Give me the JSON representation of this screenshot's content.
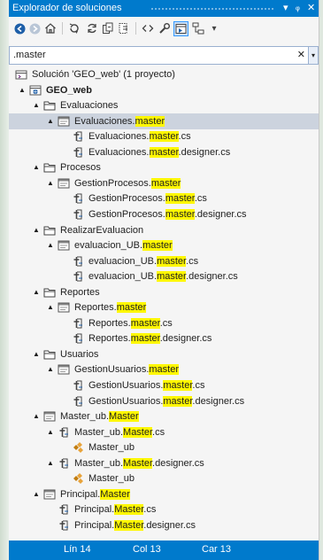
{
  "window": {
    "title": "Explorador de soluciones",
    "menu_glyph": "▾",
    "pin_glyph": "ᵩ",
    "close_glyph": "✕"
  },
  "search": {
    "value": ".master",
    "clear_glyph": "✕",
    "dropdown_glyph": "▾"
  },
  "tree": [
    {
      "depth": 0,
      "expander": "",
      "icon": "solution-icon",
      "parts": [
        {
          "t": "Solución 'GEO_web' (1 proyecto)"
        }
      ]
    },
    {
      "depth": 1,
      "expander": "▲",
      "icon": "web-project-icon",
      "bold": true,
      "parts": [
        {
          "t": "GEO_web"
        }
      ]
    },
    {
      "depth": 2,
      "expander": "▲",
      "icon": "folder-icon",
      "parts": [
        {
          "t": "Evaluaciones"
        }
      ]
    },
    {
      "depth": 3,
      "expander": "▲",
      "icon": "master-page-icon",
      "selected": true,
      "parts": [
        {
          "t": "Evaluaciones."
        },
        {
          "t": "master",
          "hl": true
        }
      ]
    },
    {
      "depth": 4,
      "expander": "",
      "icon": "cs-file-icon",
      "parts": [
        {
          "t": "Evaluaciones."
        },
        {
          "t": "master",
          "hl": true
        },
        {
          "t": ".cs"
        }
      ]
    },
    {
      "depth": 4,
      "expander": "",
      "icon": "cs-file-icon",
      "parts": [
        {
          "t": "Evaluaciones."
        },
        {
          "t": "master",
          "hl": true
        },
        {
          "t": ".designer.cs"
        }
      ]
    },
    {
      "depth": 2,
      "expander": "▲",
      "icon": "folder-icon",
      "parts": [
        {
          "t": "Procesos"
        }
      ]
    },
    {
      "depth": 3,
      "expander": "▲",
      "icon": "master-page-icon",
      "parts": [
        {
          "t": "GestionProcesos."
        },
        {
          "t": "master",
          "hl": true
        }
      ]
    },
    {
      "depth": 4,
      "expander": "",
      "icon": "cs-file-icon",
      "parts": [
        {
          "t": "GestionProcesos."
        },
        {
          "t": "master",
          "hl": true
        },
        {
          "t": ".cs"
        }
      ]
    },
    {
      "depth": 4,
      "expander": "",
      "icon": "cs-file-icon",
      "parts": [
        {
          "t": "GestionProcesos."
        },
        {
          "t": "master",
          "hl": true
        },
        {
          "t": ".designer.cs"
        }
      ]
    },
    {
      "depth": 2,
      "expander": "▲",
      "icon": "folder-icon",
      "parts": [
        {
          "t": "RealizarEvaluacion"
        }
      ]
    },
    {
      "depth": 3,
      "expander": "▲",
      "icon": "master-page-icon",
      "parts": [
        {
          "t": "evaluacion_UB."
        },
        {
          "t": "master",
          "hl": true
        }
      ]
    },
    {
      "depth": 4,
      "expander": "",
      "icon": "cs-file-icon",
      "parts": [
        {
          "t": "evaluacion_UB."
        },
        {
          "t": "master",
          "hl": true
        },
        {
          "t": ".cs"
        }
      ]
    },
    {
      "depth": 4,
      "expander": "",
      "icon": "cs-file-icon",
      "parts": [
        {
          "t": "evaluacion_UB."
        },
        {
          "t": "master",
          "hl": true
        },
        {
          "t": ".designer.cs"
        }
      ]
    },
    {
      "depth": 2,
      "expander": "▲",
      "icon": "folder-icon",
      "parts": [
        {
          "t": "Reportes"
        }
      ]
    },
    {
      "depth": 3,
      "expander": "▲",
      "icon": "master-page-icon",
      "parts": [
        {
          "t": "Reportes."
        },
        {
          "t": "master",
          "hl": true
        }
      ]
    },
    {
      "depth": 4,
      "expander": "",
      "icon": "cs-file-icon",
      "parts": [
        {
          "t": "Reportes."
        },
        {
          "t": "master",
          "hl": true
        },
        {
          "t": ".cs"
        }
      ]
    },
    {
      "depth": 4,
      "expander": "",
      "icon": "cs-file-icon",
      "parts": [
        {
          "t": "Reportes."
        },
        {
          "t": "master",
          "hl": true
        },
        {
          "t": ".designer.cs"
        }
      ]
    },
    {
      "depth": 2,
      "expander": "▲",
      "icon": "folder-icon",
      "parts": [
        {
          "t": "Usuarios"
        }
      ]
    },
    {
      "depth": 3,
      "expander": "▲",
      "icon": "master-page-icon",
      "parts": [
        {
          "t": "GestionUsuarios."
        },
        {
          "t": "master",
          "hl": true
        }
      ]
    },
    {
      "depth": 4,
      "expander": "",
      "icon": "cs-file-icon",
      "parts": [
        {
          "t": "GestionUsuarios."
        },
        {
          "t": "master",
          "hl": true
        },
        {
          "t": ".cs"
        }
      ]
    },
    {
      "depth": 4,
      "expander": "",
      "icon": "cs-file-icon",
      "parts": [
        {
          "t": "GestionUsuarios."
        },
        {
          "t": "master",
          "hl": true
        },
        {
          "t": ".designer.cs"
        }
      ]
    },
    {
      "depth": 2,
      "expander": "▲",
      "icon": "master-page-icon",
      "parts": [
        {
          "t": "Master_ub."
        },
        {
          "t": "Master",
          "hl": true
        }
      ]
    },
    {
      "depth": 3,
      "expander": "▲",
      "icon": "cs-file-icon",
      "parts": [
        {
          "t": "Master_ub."
        },
        {
          "t": "Master",
          "hl": true
        },
        {
          "t": ".cs"
        }
      ]
    },
    {
      "depth": 4,
      "expander": "",
      "icon": "class-icon",
      "parts": [
        {
          "t": "Master_ub"
        }
      ]
    },
    {
      "depth": 3,
      "expander": "▲",
      "icon": "cs-file-icon",
      "parts": [
        {
          "t": "Master_ub."
        },
        {
          "t": "Master",
          "hl": true
        },
        {
          "t": ".designer.cs"
        }
      ]
    },
    {
      "depth": 4,
      "expander": "",
      "icon": "class-icon",
      "parts": [
        {
          "t": "Master_ub"
        }
      ]
    },
    {
      "depth": 2,
      "expander": "▲",
      "icon": "master-page-icon",
      "parts": [
        {
          "t": "Principal."
        },
        {
          "t": "Master",
          "hl": true
        }
      ]
    },
    {
      "depth": 3,
      "expander": "",
      "icon": "cs-file-icon",
      "parts": [
        {
          "t": "Principal."
        },
        {
          "t": "Master",
          "hl": true
        },
        {
          "t": ".cs"
        }
      ]
    },
    {
      "depth": 3,
      "expander": "",
      "icon": "cs-file-icon",
      "parts": [
        {
          "t": "Principal."
        },
        {
          "t": "Master",
          "hl": true
        },
        {
          "t": ".designer.cs"
        }
      ]
    }
  ],
  "status": {
    "line": "Lín 14",
    "col": "Col 13",
    "char": "Car 13"
  },
  "colors": {
    "accent": "#007acc",
    "highlight": "#fff700",
    "selection": "#ccd3de"
  }
}
